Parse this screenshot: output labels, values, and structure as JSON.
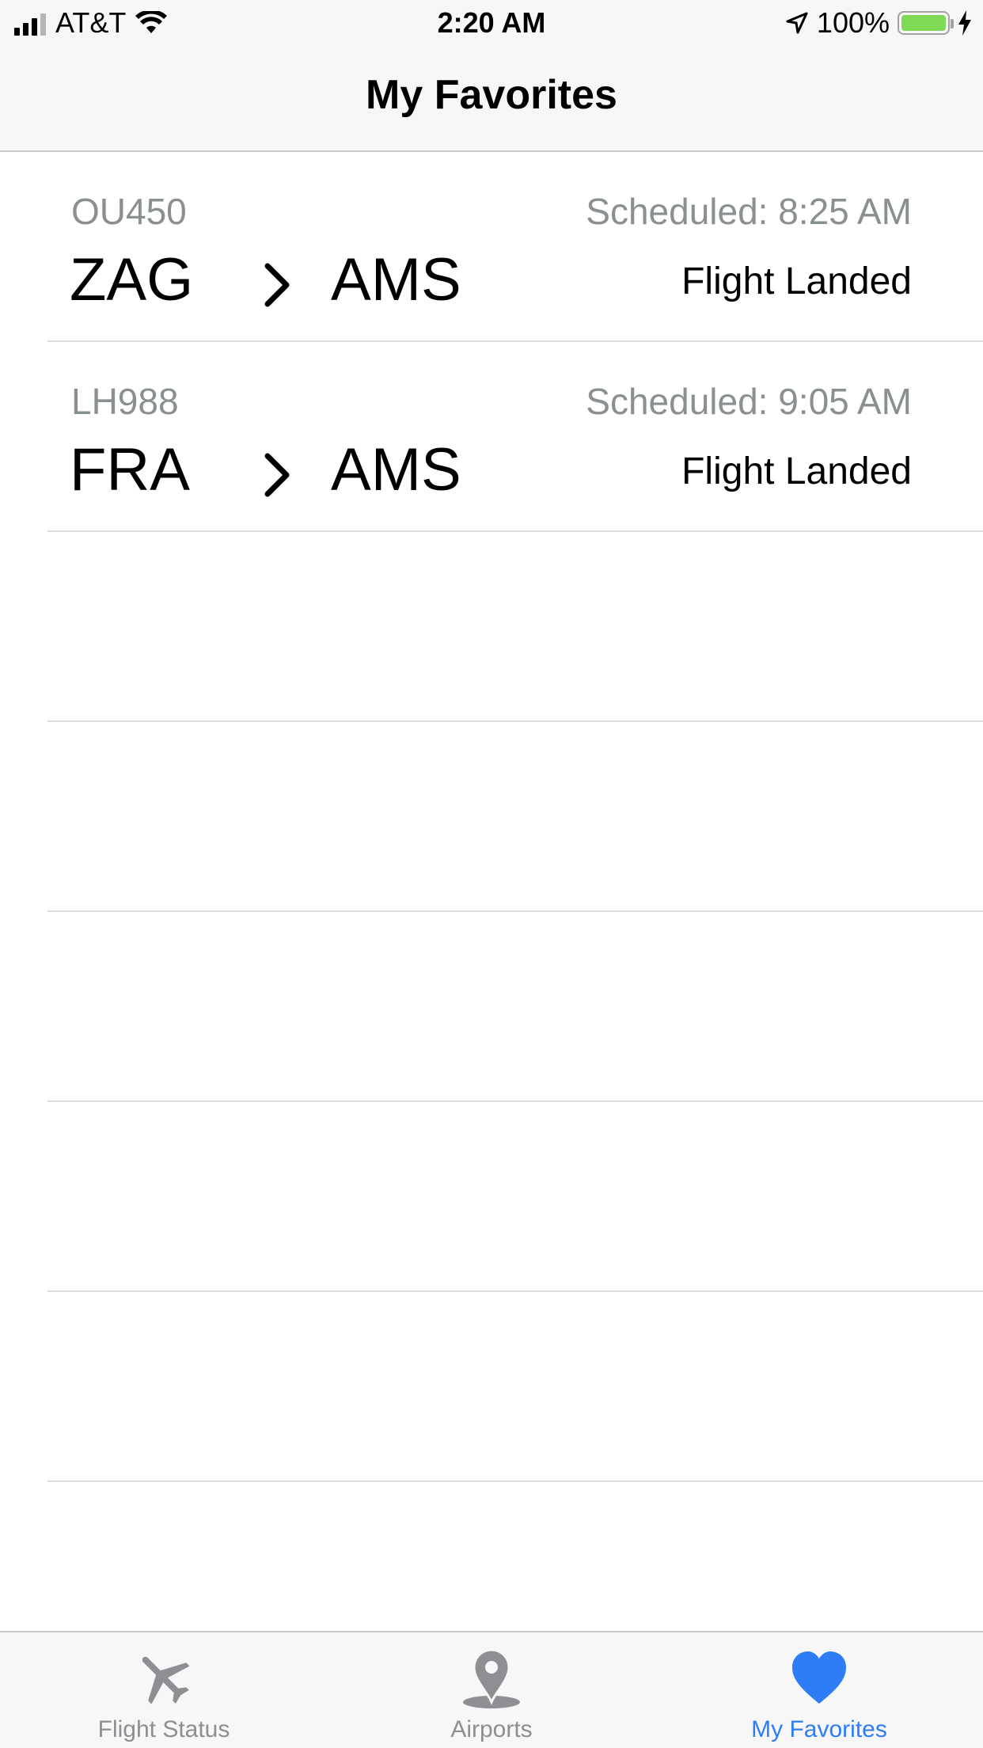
{
  "status_bar": {
    "carrier": "AT&T",
    "time": "2:20 AM",
    "battery_percent": "100%",
    "battery_level": 1.0,
    "battery_color": "#7ed957"
  },
  "nav": {
    "title": "My Favorites"
  },
  "favorites": [
    {
      "flight": "OU450",
      "scheduled": "Scheduled: 8:25 AM",
      "origin": "ZAG",
      "destination": "AMS",
      "status": "Flight Landed"
    },
    {
      "flight": "LH988",
      "scheduled": "Scheduled: 9:05 AM",
      "origin": "FRA",
      "destination": "AMS",
      "status": "Flight Landed"
    }
  ],
  "tabs": [
    {
      "label": "Flight Status",
      "icon": "airplane-icon",
      "active": false
    },
    {
      "label": "Airports",
      "icon": "location-pin-icon",
      "active": false
    },
    {
      "label": "My Favorites",
      "icon": "heart-icon",
      "active": true
    }
  ],
  "colors": {
    "tab_active": "#2e7cf6",
    "tab_inactive": "#8e8e93"
  }
}
